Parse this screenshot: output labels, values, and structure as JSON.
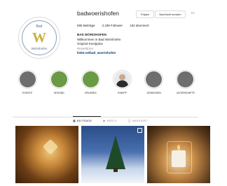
{
  "profile": {
    "username": "badwoerishofen",
    "follow_label": "Folgen",
    "message_label": "Nachricht senden",
    "more_label": "···",
    "stats": {
      "posts": "695 Beiträge",
      "followers": "3.188 Follower",
      "following": "152 abonniert"
    },
    "bio": {
      "name": "BAD WÖRISHOFEN",
      "line1": "Willkommen in Bad Wörishofen",
      "line2": "Original Kneippkur",
      "line3": "Reiseführer",
      "link": "linktr.ee/bad_woerishofen"
    },
    "logo": {
      "top": "Bad",
      "letter": "W",
      "bottom": "Wörishofen"
    }
  },
  "highlights": [
    {
      "label": "EVENTS",
      "color": "#6e6e6e",
      "type": "circle"
    },
    {
      "label": "GESUND",
      "color": "#6b9a45",
      "type": "circle"
    },
    {
      "label": "ERLEBEN",
      "color": "#6b9a45",
      "type": "circle"
    },
    {
      "label": "KNEIPP",
      "color": "",
      "type": "person"
    },
    {
      "label": "GENIESSEN",
      "color": "#6e6e6e",
      "type": "circle"
    },
    {
      "label": "UNTERKÜNFTE",
      "color": "#6e6e6e",
      "type": "circle"
    }
  ],
  "tabs": [
    {
      "label": "BEITRÄGE",
      "active": true
    },
    {
      "label": "REELS",
      "active": false
    },
    {
      "label": "MARKIERT",
      "active": false
    }
  ],
  "posts": [
    {
      "name": "post-christmas-ornament"
    },
    {
      "name": "post-christmas-tree-snow"
    },
    {
      "name": "post-candle-lantern"
    }
  ],
  "colors": {
    "highlight_green": "#6b9a45",
    "highlight_gray": "#6e6e6e",
    "link": "#00376b"
  }
}
